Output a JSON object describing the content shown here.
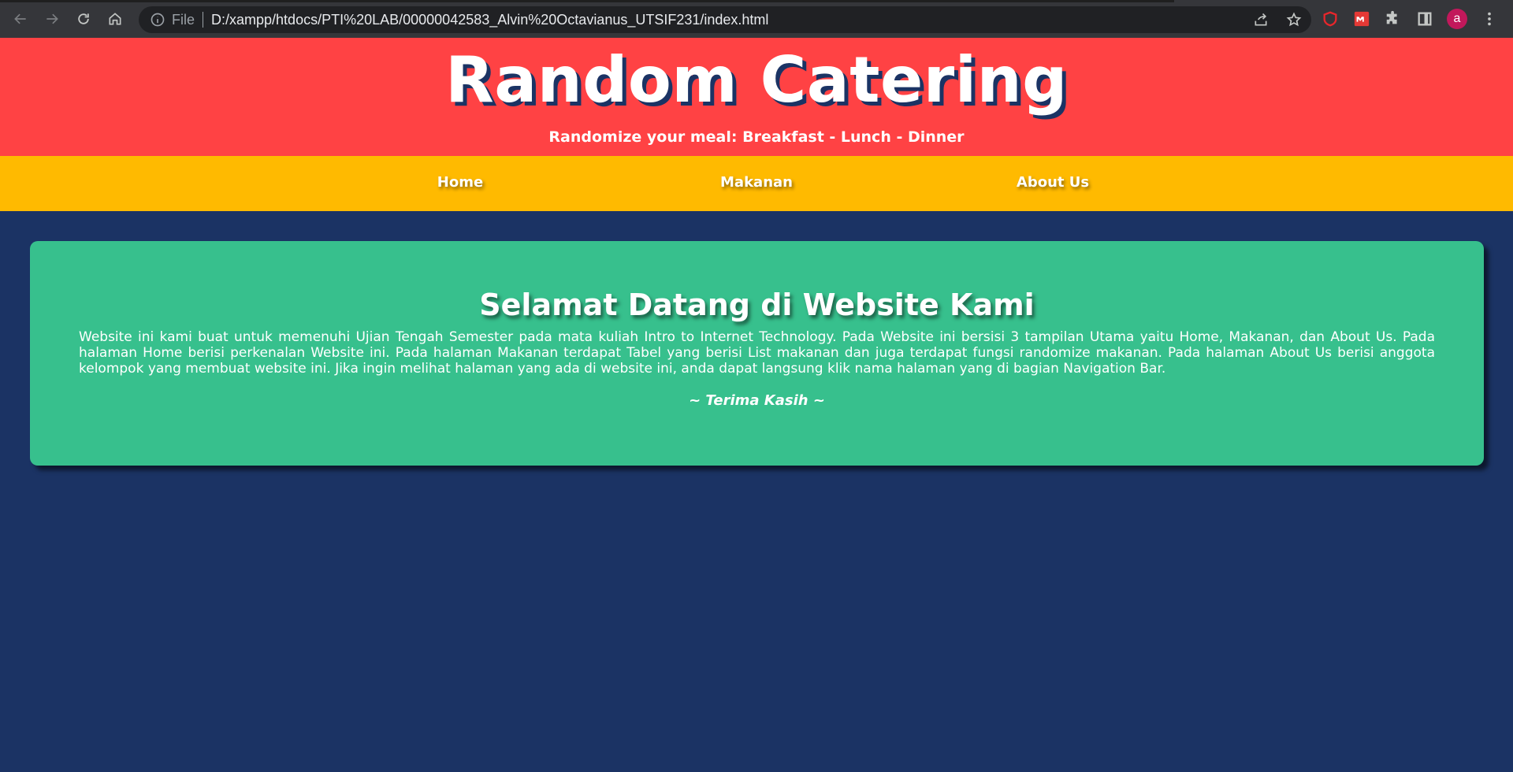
{
  "browser": {
    "file_label": "File",
    "url": "D:/xampp/htdocs/PTI%20LAB/00000042583_Alvin%20Octavianus_UTSIF231/index.html",
    "avatar_letter": "a",
    "icons": [
      "back-icon",
      "forward-icon",
      "reload-icon",
      "home-icon",
      "info-icon",
      "share-icon",
      "star-icon",
      "shield-extension-icon",
      "red-extension-icon",
      "puzzle-icon",
      "sidebar-icon",
      "avatar",
      "kebab-menu-icon"
    ]
  },
  "header": {
    "title": "Random Catering",
    "tagline": "Randomize your meal: Breakfast - Lunch - Dinner"
  },
  "nav": {
    "items": [
      "Home",
      "Makanan",
      "About Us"
    ]
  },
  "card": {
    "title": "Selamat Datang di Website Kami",
    "body": "Website ini kami buat untuk memenuhi Ujian Tengah Semester pada mata kuliah Intro to Internet Technology. Pada Website ini bersisi 3 tampilan Utama yaitu Home, Makanan, dan About Us. Pada halaman Home berisi perkenalan Website ini. Pada halaman Makanan terdapat Tabel yang berisi List makanan dan juga terdapat fungsi randomize makanan. Pada halaman About Us berisi anggota kelompok yang membuat website ini. Jika ingin melihat halaman yang ada di website ini, anda dapat langsung klik nama halaman yang di bagian Navigation Bar.",
    "thanks": "~ Terima Kasih ~"
  },
  "colors": {
    "header": "#ff4244",
    "navbar": "#ffba00",
    "page_bg": "#1b3364",
    "card": "#37c08d"
  }
}
